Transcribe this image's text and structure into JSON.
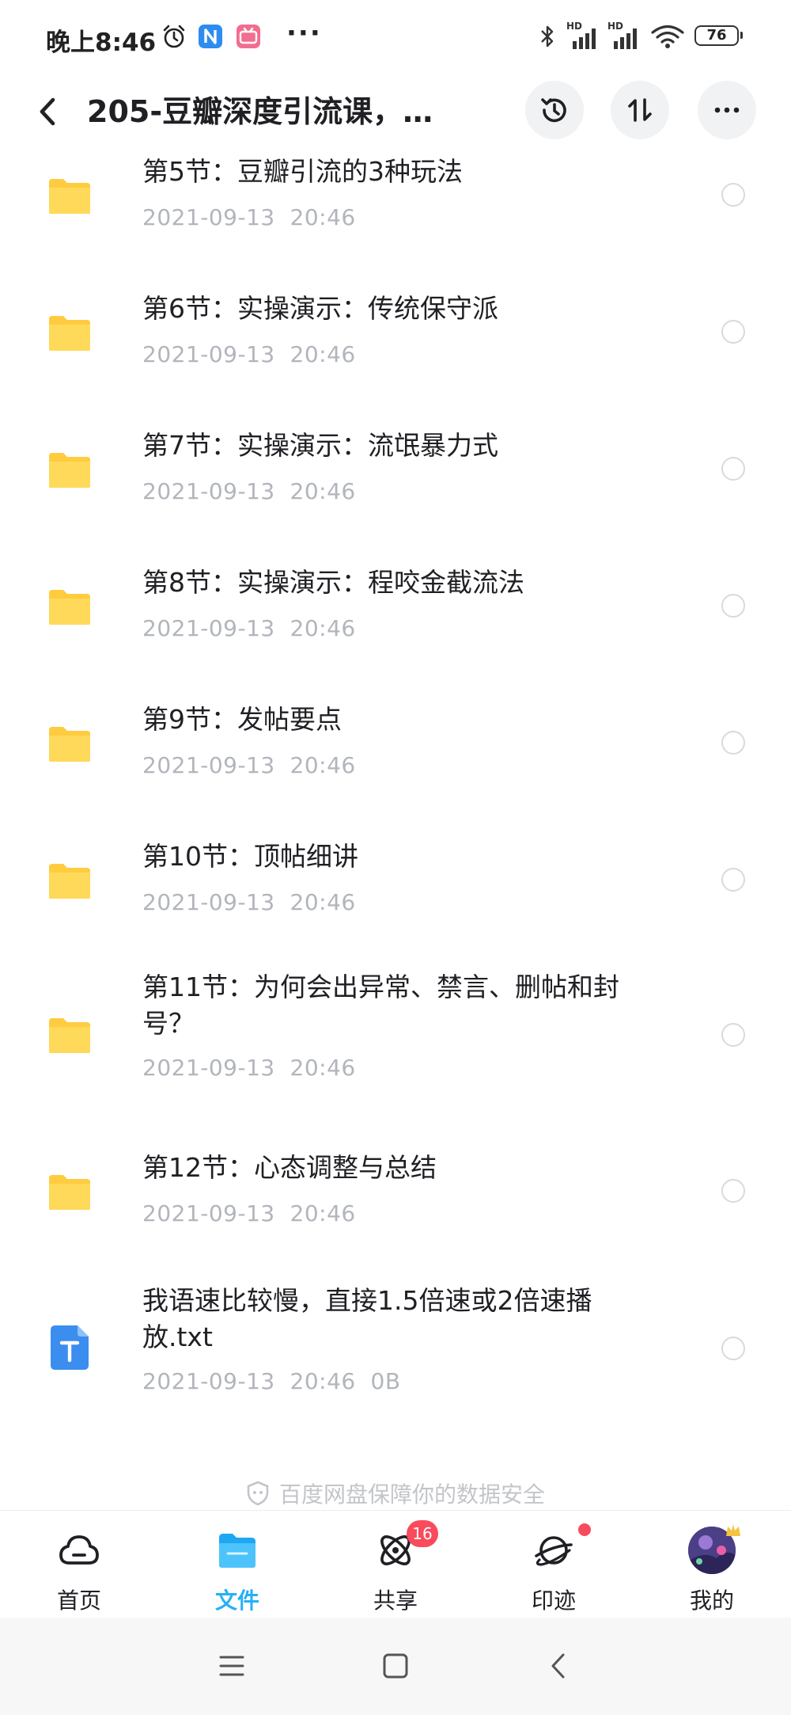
{
  "status_bar": {
    "time": "晚上8:46",
    "battery": "76",
    "more_label": "···",
    "network_labels": [
      "HD",
      "HD"
    ]
  },
  "header": {
    "title": "205-豆瓣深度引流课，…",
    "back_icon": "chevron-left-icon",
    "history_icon": "history-icon",
    "sort_icon": "sort-icon",
    "more_icon": "more-horizontal-icon"
  },
  "files": [
    {
      "type": "folder",
      "name": "第5节：豆瓣引流的3种玩法",
      "meta": "2021-09-13  20:46"
    },
    {
      "type": "folder",
      "name": "第6节：实操演示：传统保守派",
      "meta": "2021-09-13  20:46"
    },
    {
      "type": "folder",
      "name": "第7节：实操演示：流氓暴力式",
      "meta": "2021-09-13  20:46"
    },
    {
      "type": "folder",
      "name": "第8节：实操演示：程咬金截流法",
      "meta": "2021-09-13  20:46"
    },
    {
      "type": "folder",
      "name": "第9节：发帖要点",
      "meta": "2021-09-13  20:46"
    },
    {
      "type": "folder",
      "name": "第10节：顶帖细讲",
      "meta": "2021-09-13  20:46"
    },
    {
      "type": "folder",
      "name": "第11节：为何会出异常、禁言、删帖和封号？",
      "meta": "2021-09-13  20:46"
    },
    {
      "type": "folder",
      "name": "第12节：心态调整与总结",
      "meta": "2021-09-13  20:46"
    },
    {
      "type": "txt",
      "name": "我语速比较慢，直接1.5倍速或2倍速播放.txt",
      "meta": "2021-09-13  20:46  0B"
    }
  ],
  "footer_note": "百度网盘保障你的数据安全",
  "tabs": [
    {
      "label": "首页",
      "icon": "cloud-icon"
    },
    {
      "label": "文件",
      "icon": "folder-icon",
      "active": true
    },
    {
      "label": "共享",
      "icon": "share-orbit-icon",
      "badge": "16"
    },
    {
      "label": "印迹",
      "icon": "planet-icon",
      "dot": true
    },
    {
      "label": "我的",
      "icon": "avatar"
    }
  ],
  "colors": {
    "accent": "#25b1f5",
    "folder": "#ffd54c",
    "badge": "#f84b5c",
    "muted_text": "#b2b5bc",
    "txt_icon": "#3b8ef0"
  }
}
